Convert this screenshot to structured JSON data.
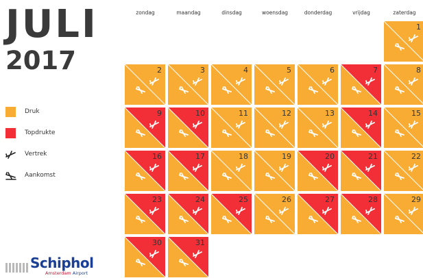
{
  "header": {
    "month": "JULI",
    "year": "2017"
  },
  "weekdays": [
    "zondag",
    "maandag",
    "dinsdag",
    "woensdag",
    "donderdag",
    "vrijdag",
    "zaterdag"
  ],
  "legend": {
    "busy": "Druk",
    "peak": "Topdrukte",
    "departure": "Vertrek",
    "arrival": "Aankomst"
  },
  "colors": {
    "busy": "#f9ac33",
    "peak": "#f22f37"
  },
  "logo": {
    "name": "Schiphol",
    "subtitle_city": "Amsterdam",
    "subtitle_word": "Airport"
  },
  "calendar": {
    "first_weekday_index": 6,
    "days": [
      {
        "day": "1",
        "departure": "busy",
        "arrival": "busy"
      },
      {
        "day": "2",
        "departure": "busy",
        "arrival": "busy"
      },
      {
        "day": "3",
        "departure": "busy",
        "arrival": "busy"
      },
      {
        "day": "4",
        "departure": "busy",
        "arrival": "busy"
      },
      {
        "day": "5",
        "departure": "busy",
        "arrival": "busy"
      },
      {
        "day": "6",
        "departure": "busy",
        "arrival": "busy"
      },
      {
        "day": "7",
        "departure": "peak",
        "arrival": "busy"
      },
      {
        "day": "8",
        "departure": "busy",
        "arrival": "busy"
      },
      {
        "day": "9",
        "departure": "peak",
        "arrival": "busy"
      },
      {
        "day": "10",
        "departure": "peak",
        "arrival": "busy"
      },
      {
        "day": "11",
        "departure": "busy",
        "arrival": "busy"
      },
      {
        "day": "12",
        "departure": "busy",
        "arrival": "busy"
      },
      {
        "day": "13",
        "departure": "busy",
        "arrival": "busy"
      },
      {
        "day": "14",
        "departure": "peak",
        "arrival": "busy"
      },
      {
        "day": "15",
        "departure": "busy",
        "arrival": "busy"
      },
      {
        "day": "16",
        "departure": "peak",
        "arrival": "busy"
      },
      {
        "day": "17",
        "departure": "peak",
        "arrival": "busy"
      },
      {
        "day": "18",
        "departure": "busy",
        "arrival": "busy"
      },
      {
        "day": "19",
        "departure": "busy",
        "arrival": "busy"
      },
      {
        "day": "20",
        "departure": "peak",
        "arrival": "busy"
      },
      {
        "day": "21",
        "departure": "peak",
        "arrival": "busy"
      },
      {
        "day": "22",
        "departure": "busy",
        "arrival": "busy"
      },
      {
        "day": "23",
        "departure": "peak",
        "arrival": "busy"
      },
      {
        "day": "24",
        "departure": "peak",
        "arrival": "busy"
      },
      {
        "day": "25",
        "departure": "peak",
        "arrival": "busy"
      },
      {
        "day": "26",
        "departure": "busy",
        "arrival": "busy"
      },
      {
        "day": "27",
        "departure": "peak",
        "arrival": "busy"
      },
      {
        "day": "28",
        "departure": "peak",
        "arrival": "busy"
      },
      {
        "day": "29",
        "departure": "busy",
        "arrival": "busy"
      },
      {
        "day": "30",
        "departure": "peak",
        "arrival": "busy"
      },
      {
        "day": "31",
        "departure": "peak",
        "arrival": "busy"
      }
    ]
  }
}
